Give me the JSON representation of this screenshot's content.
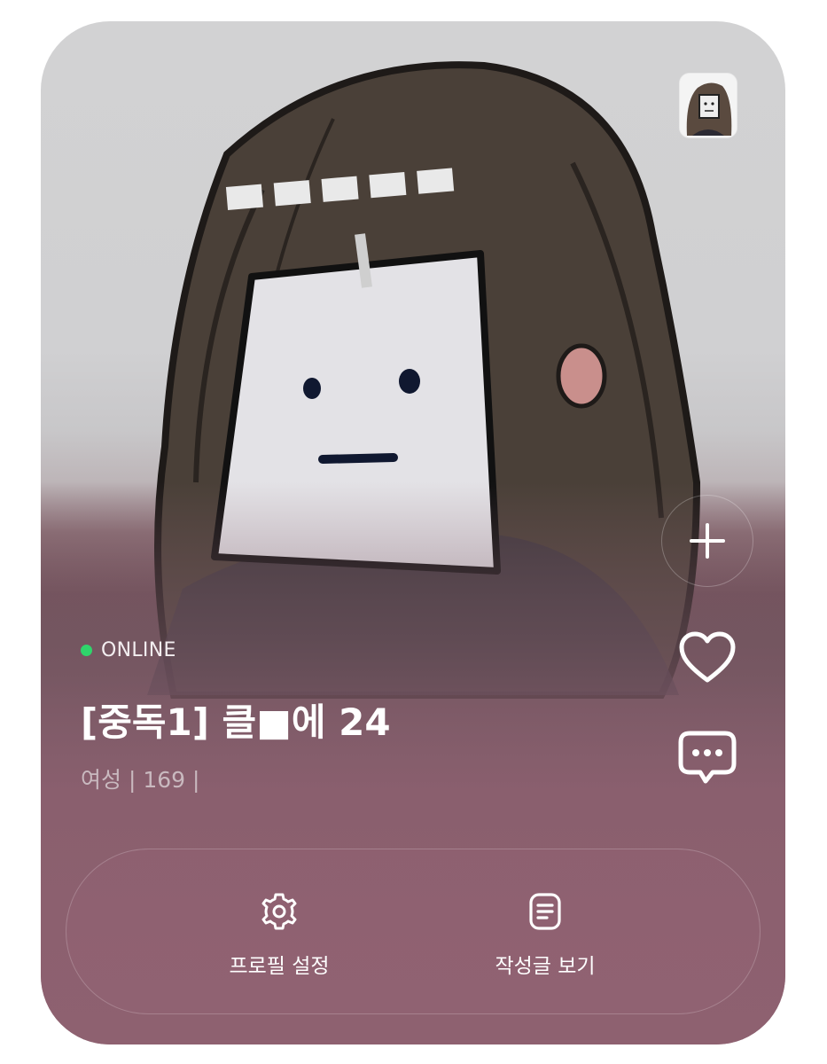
{
  "profile": {
    "status": "ONLINE",
    "name": "[중독1] 클■에 24",
    "meta": "여성 | 169 |"
  },
  "side_actions": {
    "add_icon": "plus-icon",
    "like_icon": "heart-icon",
    "message_icon": "chat-bubble-icon"
  },
  "actions": {
    "settings_label": "프로필 설정",
    "settings_icon": "gear-icon",
    "posts_label": "작성글 보기",
    "posts_icon": "document-icon"
  },
  "colors": {
    "online": "#2fd56b",
    "card_bottom": "#8e6170"
  }
}
